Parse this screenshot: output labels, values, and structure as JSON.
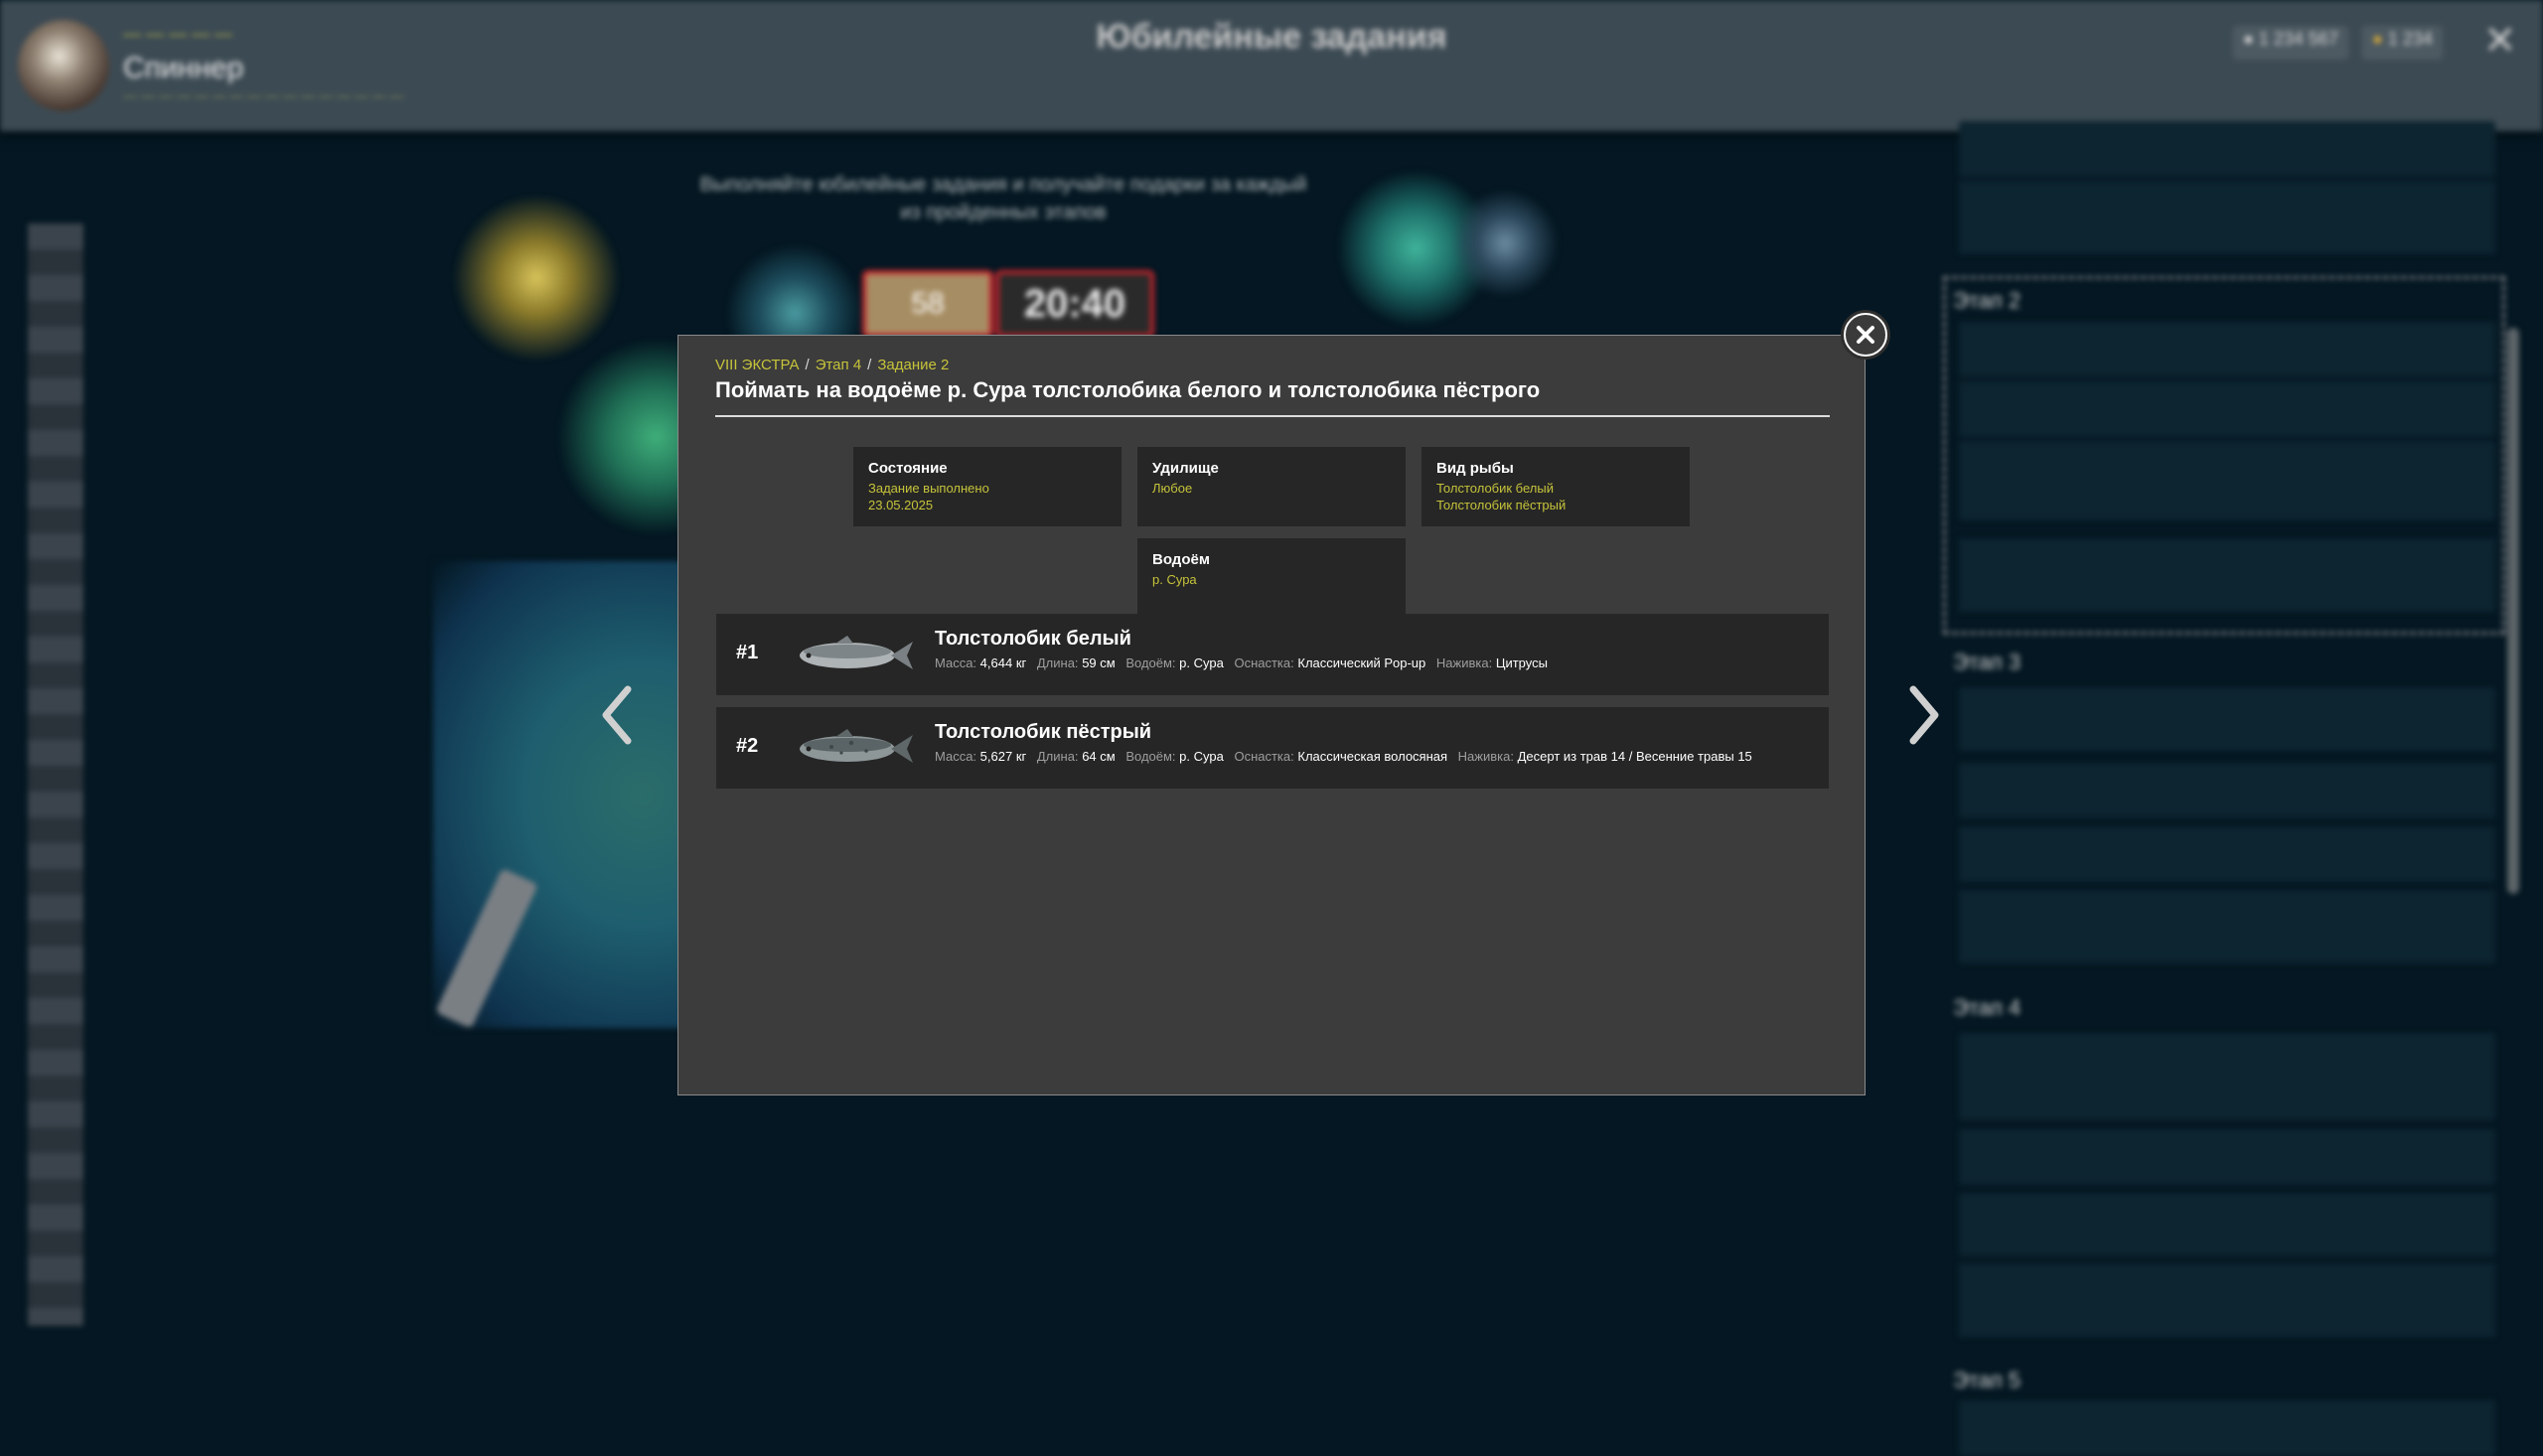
{
  "background": {
    "player_level": "— — — — —",
    "player_name": "Спиннер",
    "player_subtitle": "— — — — — — — — — — — — — — — —",
    "page_title": "Юбилейные задания",
    "currency_silver": "1 234 567",
    "currency_gold": "1 234",
    "promo_text": "Выполняйте юбилейные задания и получайте подарки за каждый из пройденных этапов",
    "timer_days": "58",
    "timer_clock": "20:40",
    "stage_headers": [
      "Этап 2",
      "Этап 3",
      "Этап 4",
      "Этап 5"
    ]
  },
  "modal": {
    "breadcrumb": [
      "VIII ЭКСТРА",
      "Этап 4",
      "Задание 2"
    ],
    "title": "Поймать на водоёме р. Сура толстолобика белого и толстолобика пёстрого",
    "info": {
      "state": {
        "label": "Состояние",
        "values": [
          "Задание выполнено",
          "23.05.2025"
        ]
      },
      "rod": {
        "label": "Удилище",
        "values": [
          "Любое"
        ]
      },
      "fish_type": {
        "label": "Вид рыбы",
        "values": [
          "Толстолобик белый",
          "Толстолобик пёстрый"
        ]
      },
      "waterbody": {
        "label": "Водоём",
        "values": [
          "р. Сура"
        ]
      }
    },
    "stat_labels": {
      "mass": "Масса:",
      "length": "Длина:",
      "waterbody": "Водоём:",
      "tackle": "Оснастка:",
      "bait": "Наживка:"
    },
    "catches": [
      {
        "num": "#1",
        "name": "Толстолобик белый",
        "mass": "4,644 кг",
        "length": "59 см",
        "waterbody": "р. Сура",
        "tackle": "Классический Pop-up",
        "bait": "Цитрусы"
      },
      {
        "num": "#2",
        "name": "Толстолобик пёстрый",
        "mass": "5,627 кг",
        "length": "64 см",
        "waterbody": "р. Сура",
        "tackle": "Классическая волосяная",
        "bait": "Десерт из трав 14 / Весенние травы 15"
      }
    ]
  },
  "icons": {
    "close": "close-icon",
    "prev": "chevron-left-icon",
    "next": "chevron-right-icon",
    "fish": "fish-icon"
  },
  "colors": {
    "accent_yellow": "#c6c33a",
    "modal_bg": "#3c3c3c",
    "card_bg": "#262626",
    "page_bg": "#041722"
  }
}
